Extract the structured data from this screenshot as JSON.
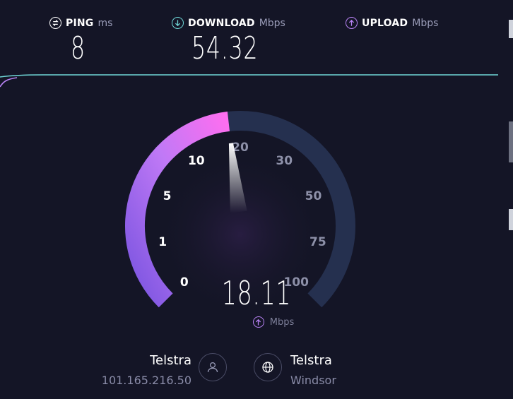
{
  "metrics": {
    "ping": {
      "label": "PING",
      "unit": "ms",
      "value": "8",
      "icon": "ping-icon",
      "color": "#ffffff"
    },
    "download": {
      "label": "DOWNLOAD",
      "unit": "Mbps",
      "value": "54.32",
      "icon": "download-arrow-icon",
      "color": "#6fd6d6"
    },
    "upload": {
      "label": "UPLOAD",
      "unit": "Mbps",
      "value": "",
      "icon": "upload-arrow-icon",
      "color": "#b983f5"
    }
  },
  "gauge": {
    "current_value": "18.11",
    "current_level": 18.11,
    "unit": "Mbps",
    "unit_icon": "upload-arrow-icon",
    "ticks": [
      "0",
      "1",
      "5",
      "10",
      "20",
      "30",
      "50",
      "75",
      "100"
    ],
    "colors": {
      "fill_start": "#7a54e0",
      "fill_end": "#ff6ef0",
      "track": "#25304f"
    }
  },
  "isp": {
    "name": "Telstra",
    "ip": "101.165.216.50",
    "icon": "user-icon"
  },
  "server": {
    "name": "Telstra",
    "location": "Windsor",
    "icon": "globe-icon"
  }
}
